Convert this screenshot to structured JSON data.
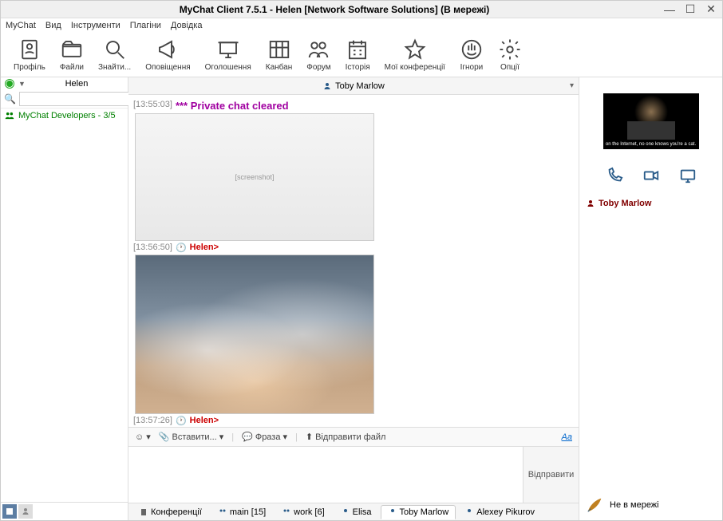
{
  "title": "MyChat Client 7.5.1 - Helen [Network Software Solutions] (В мережі)",
  "menu": {
    "mychat": "MyChat",
    "view": "Вид",
    "tools": "Інструменти",
    "plugins": "Плагіни",
    "help": "Довідка"
  },
  "toolbar": {
    "profile": "Профіль",
    "files": "Файли",
    "find": "Знайти...",
    "notifications": "Оповіщення",
    "announcements": "Оголошення",
    "kanban": "Канбан",
    "forum": "Форум",
    "history": "Історія",
    "myconf": "Мої конференції",
    "ignores": "Ігнори",
    "options": "Опції"
  },
  "left": {
    "username": "Helen",
    "search_placeholder": "",
    "contact": "MyChat Developers - 3/5"
  },
  "chat": {
    "partner": "Toby Marlow",
    "messages": [
      {
        "time": "[13:55:03]",
        "system": "*** Private chat cleared"
      },
      {
        "time": "[13:56:50]",
        "sender": "Helen>"
      },
      {
        "time": "[13:57:26]",
        "sender": "Helen>"
      }
    ]
  },
  "compose": {
    "insert": "Вставити...",
    "phrase": "Фраза",
    "sendfile": "Відправити файл",
    "aa": "Aa",
    "send": "Відправити"
  },
  "tabs": [
    {
      "label": "Конференції",
      "icon": "building"
    },
    {
      "label": "main [15]",
      "icon": "group"
    },
    {
      "label": "work [6]",
      "icon": "group"
    },
    {
      "label": "Elisa",
      "icon": "person"
    },
    {
      "label": "Toby Marlow",
      "icon": "person",
      "active": true
    },
    {
      "label": "Alexey Pikurov",
      "icon": "person"
    }
  ],
  "right": {
    "avatar_caption": "on the Internet, no one knows you're a cat.",
    "name": "Toby Marlow",
    "status": "Не в мережі"
  }
}
